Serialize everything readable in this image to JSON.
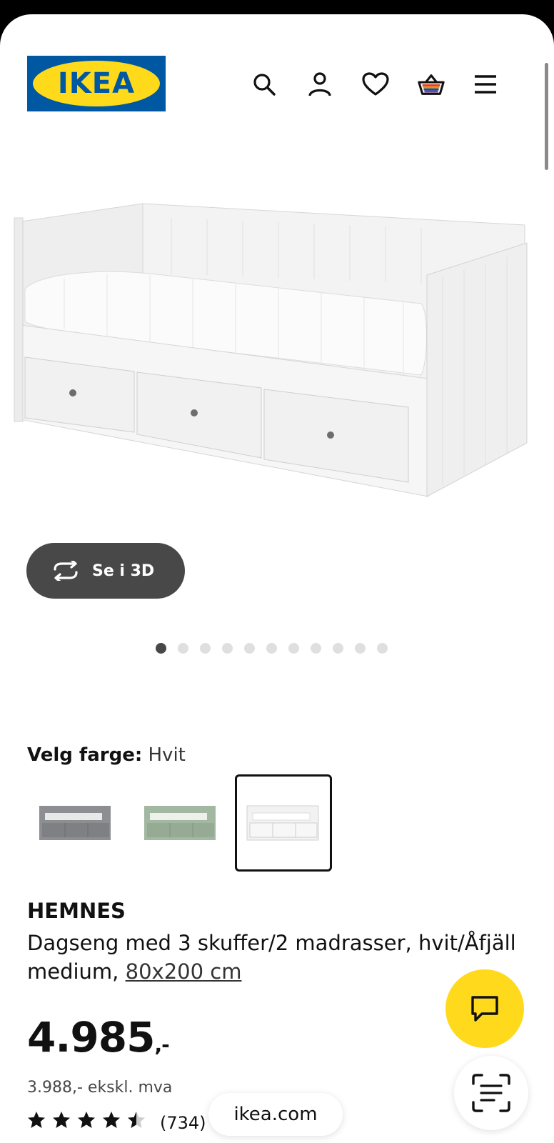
{
  "header": {
    "logo_text": "IKEA",
    "icons": [
      "search-icon",
      "account-icon",
      "heart-icon",
      "basket-icon",
      "menu-icon"
    ]
  },
  "gallery": {
    "view_3d_label": "Se i 3D",
    "total_images": 11,
    "active_index": 0
  },
  "color": {
    "label": "Velg farge:",
    "value": "Hvit",
    "options": [
      {
        "name": "grey",
        "hex": "#8d8e92"
      },
      {
        "name": "green",
        "hex": "#a3b8a2"
      },
      {
        "name": "white",
        "hex": "#f2f2f2",
        "selected": true
      }
    ]
  },
  "product": {
    "name": "HEMNES",
    "description": "Dagseng med 3 skuffer/2 madrasser, hvit/Åfjäll medium, ",
    "size": "80x200 cm",
    "price_main": "4.985",
    "price_suffix": ",-",
    "price_ex_vat": "3.988,- ekskl. mva",
    "rating": 4.5,
    "review_count": "(734)"
  },
  "browser": {
    "url": "ikea.com"
  },
  "colors": {
    "ikea_blue": "#0058a3",
    "ikea_yellow": "#ffda1a"
  }
}
